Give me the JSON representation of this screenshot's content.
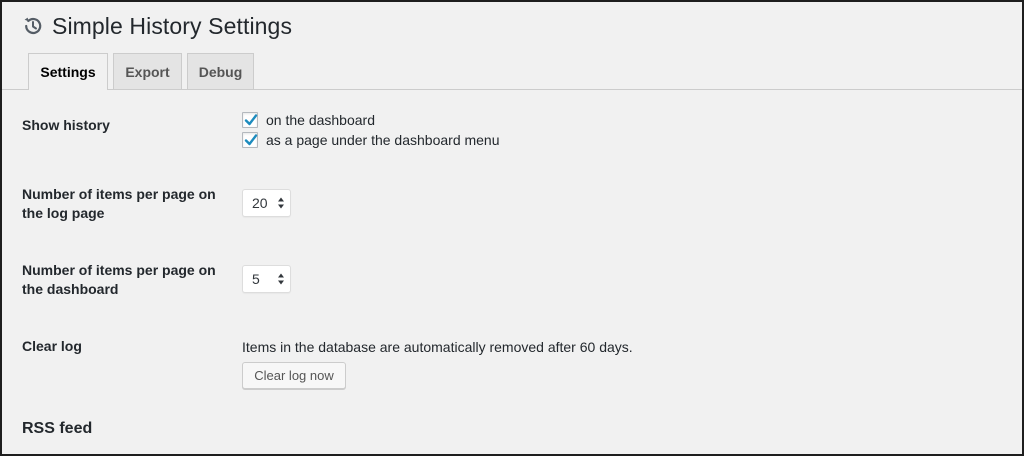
{
  "header": {
    "title": "Simple History Settings",
    "icon": "history-icon"
  },
  "tabs": [
    {
      "label": "Settings",
      "active": true
    },
    {
      "label": "Export",
      "active": false
    },
    {
      "label": "Debug",
      "active": false
    }
  ],
  "show_history": {
    "label": "Show history",
    "options": [
      {
        "label": "on the dashboard",
        "checked": true
      },
      {
        "label": "as a page under the dashboard menu",
        "checked": true
      }
    ]
  },
  "items_log_page": {
    "label_line1": "Number of items per page on",
    "label_line2": "the log page",
    "value": "20"
  },
  "items_dashboard": {
    "label_line1": "Number of items per page on",
    "label_line2": "the dashboard",
    "value": "5"
  },
  "clear_log": {
    "label": "Clear log",
    "description": "Items in the database are automatically removed after 60 days.",
    "button_label": "Clear log now"
  },
  "rss_feed": {
    "heading": "RSS feed"
  },
  "colors": {
    "background": "#f1f1f1",
    "checkmark": "#1e8cbe",
    "text": "#23282d",
    "tab_inactive": "#e4e4e4"
  }
}
